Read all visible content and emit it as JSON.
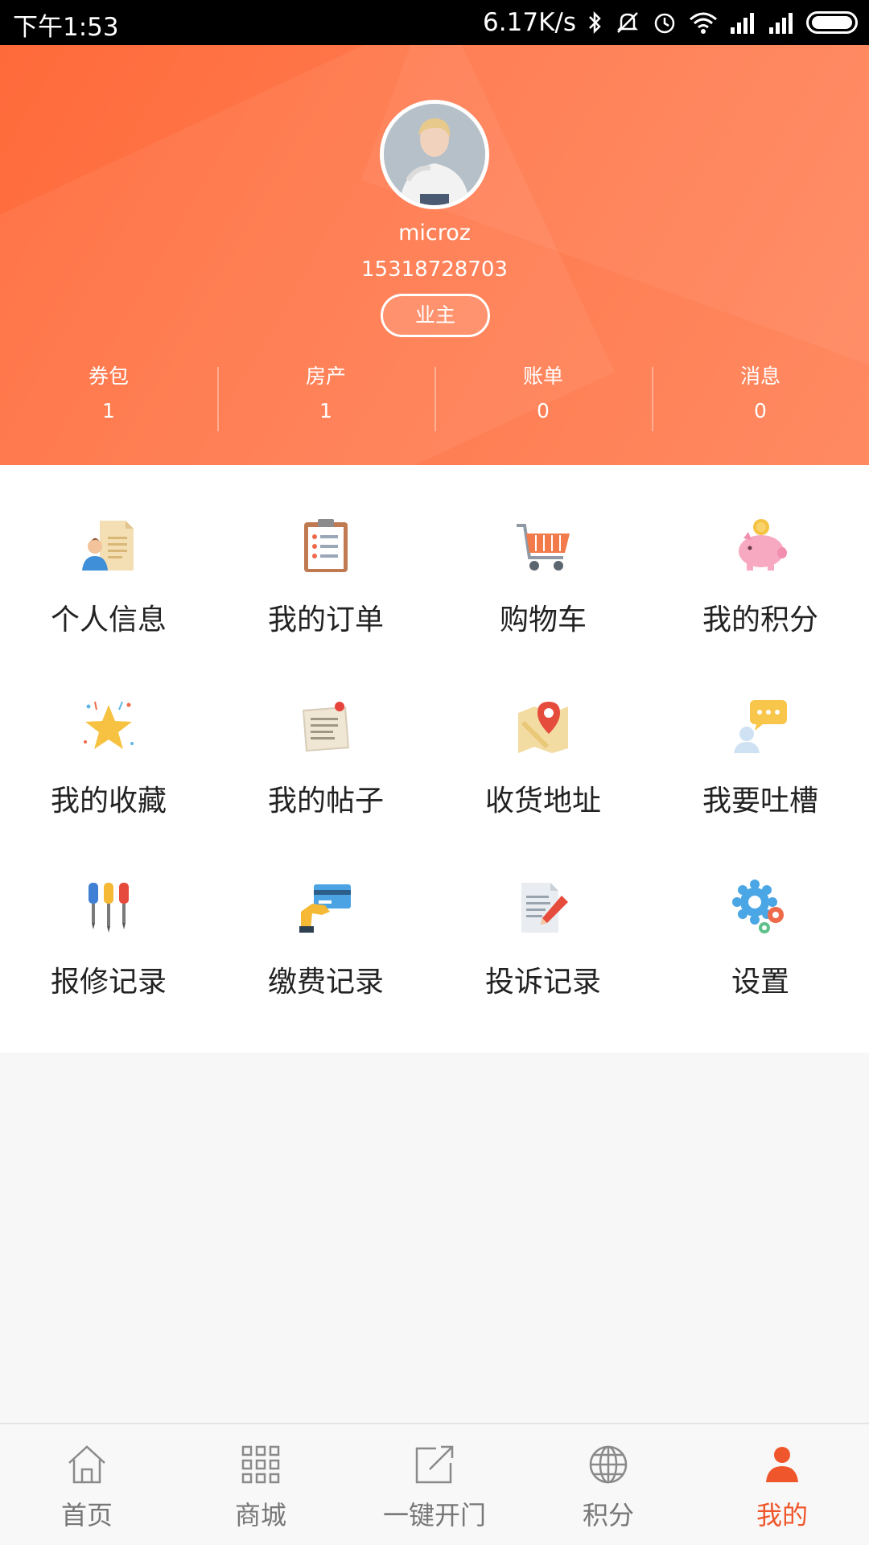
{
  "status_bar": {
    "time": "下午1:53",
    "network_speed": "6.17K/s",
    "icons": [
      "bluetooth-icon",
      "silent-icon",
      "alarm-icon",
      "wifi-icon",
      "signal-icon",
      "signal-icon",
      "battery-icon"
    ]
  },
  "profile": {
    "username": "microz",
    "phone": "15318728703",
    "role": "业主"
  },
  "stats": [
    {
      "label": "券包",
      "value": "1"
    },
    {
      "label": "房产",
      "value": "1"
    },
    {
      "label": "账单",
      "value": "0"
    },
    {
      "label": "消息",
      "value": "0"
    }
  ],
  "menu": [
    {
      "label": "个人信息",
      "icon": "person-document-icon"
    },
    {
      "label": "我的订单",
      "icon": "clipboard-icon"
    },
    {
      "label": "购物车",
      "icon": "shopping-cart-icon"
    },
    {
      "label": "我的积分",
      "icon": "piggy-bank-icon"
    },
    {
      "label": "我的收藏",
      "icon": "star-icon"
    },
    {
      "label": "我的帖子",
      "icon": "note-icon"
    },
    {
      "label": "收货地址",
      "icon": "map-pin-icon"
    },
    {
      "label": "我要吐槽",
      "icon": "chat-bubble-icon"
    },
    {
      "label": "报修记录",
      "icon": "screwdrivers-icon"
    },
    {
      "label": "缴费记录",
      "icon": "credit-card-icon"
    },
    {
      "label": "投诉记录",
      "icon": "document-pen-icon"
    },
    {
      "label": "设置",
      "icon": "gears-icon"
    }
  ],
  "tabs": [
    {
      "label": "首页",
      "icon": "home-icon"
    },
    {
      "label": "商城",
      "icon": "grid-icon"
    },
    {
      "label": "一键开门",
      "icon": "share-out-icon"
    },
    {
      "label": "积分",
      "icon": "globe-icon"
    },
    {
      "label": "我的",
      "icon": "person-icon",
      "active": true
    }
  ],
  "colors": {
    "accent": "#f0562b",
    "header_start": "#ff6a3a",
    "header_end": "#ff8a62"
  }
}
